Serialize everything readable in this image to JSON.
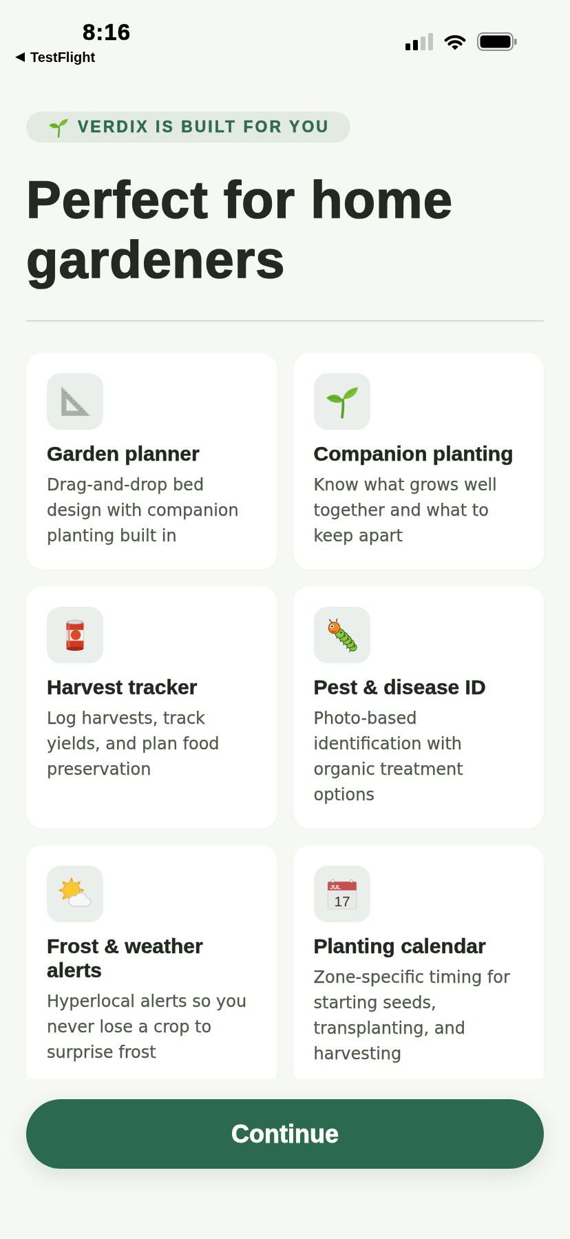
{
  "status_bar": {
    "time": "8:16",
    "back_link": "TestFlight"
  },
  "tagline": "VERDIX IS BUILT FOR YOU",
  "heading": "Perfect for home gardeners",
  "features": [
    {
      "title": "Garden planner",
      "description": "Drag-and-drop bed design with companion planting built in"
    },
    {
      "title": "Companion planting",
      "description": "Know what grows well together and what to keep apart"
    },
    {
      "title": "Harvest tracker",
      "description": "Log harvests, track yields, and plan food preservation"
    },
    {
      "title": "Pest & disease ID",
      "description": "Photo-based identification with organic treatment options"
    },
    {
      "title": "Frost & weather alerts",
      "description": "Hyperlocal alerts so you never lose a crop to surprise frost"
    },
    {
      "title": "Planting calendar",
      "description": "Zone-specific timing for starting seeds, transplanting, and harvesting"
    }
  ],
  "calendar_icon_labels": [
    "JUL",
    "17"
  ],
  "continue_button": "Continue"
}
